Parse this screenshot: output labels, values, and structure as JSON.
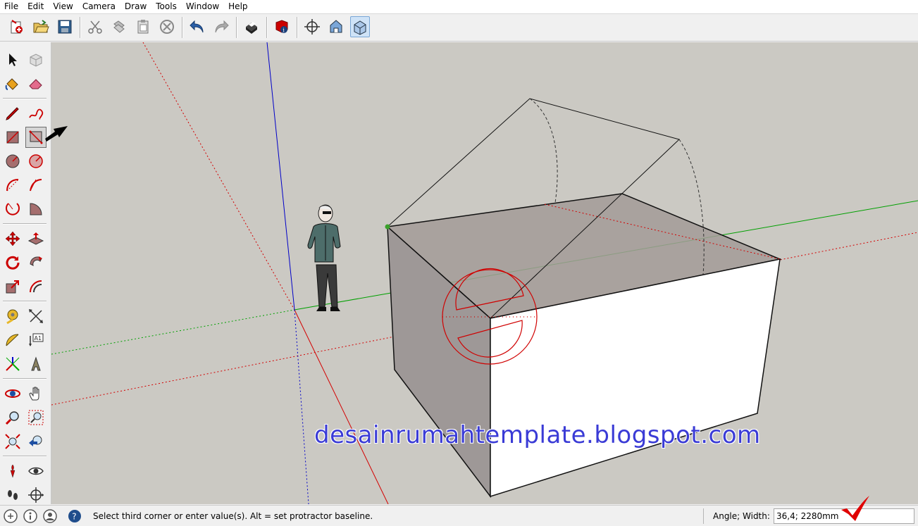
{
  "menubar": {
    "items": [
      "File",
      "Edit",
      "View",
      "Camera",
      "Draw",
      "Tools",
      "Window",
      "Help"
    ]
  },
  "toolbar": {
    "buttons": [
      {
        "name": "new-model-button",
        "icon": "new-file-icon"
      },
      {
        "name": "open-button",
        "icon": "open-folder-icon"
      },
      {
        "name": "save-button",
        "icon": "save-disk-icon"
      },
      {
        "name": "cut-button",
        "icon": "scissors-icon"
      },
      {
        "name": "copy-button",
        "icon": "copy-icon"
      },
      {
        "name": "paste-button",
        "icon": "paste-icon"
      },
      {
        "name": "erase-button",
        "icon": "delete-circle-icon"
      },
      {
        "name": "undo-button",
        "icon": "undo-arrow-icon"
      },
      {
        "name": "redo-button",
        "icon": "redo-arrow-icon"
      },
      {
        "name": "print-button",
        "icon": "printer-icon"
      },
      {
        "name": "model-info-button",
        "icon": "model-info-icon"
      },
      {
        "name": "make-component-button",
        "icon": "crosshair-icon"
      },
      {
        "name": "iso-view-button",
        "icon": "house-blue-icon"
      },
      {
        "name": "front-view-button",
        "icon": "house-box-icon"
      }
    ]
  },
  "left_tools": [
    "select-icon",
    "make-component-icon",
    "paint-bucket-icon",
    "eraser-icon",
    "pencil-line-icon",
    "freehand-icon",
    "rectangle-icon",
    "rotated-rectangle-icon",
    "circle-icon",
    "polygon-icon",
    "arc-icon",
    "two-point-arc-icon",
    "three-point-arc-icon",
    "pie-icon",
    "move-icon",
    "push-pull-icon",
    "rotate-icon",
    "follow-me-icon",
    "scale-icon",
    "offset-icon",
    "tape-measure-icon",
    "dimension-icon",
    "protractor-icon",
    "text-icon",
    "axes-icon",
    "3d-text-icon",
    "orbit-icon",
    "pan-icon",
    "zoom-icon",
    "zoom-window-icon",
    "zoom-extents-icon",
    "previous-view-icon",
    "position-camera-icon",
    "look-around-icon",
    "walk-icon",
    "section-plane-icon"
  ],
  "viewport": {
    "watermark": "desainrumahtemplate.blogspot.com"
  },
  "statusbar": {
    "message": "Select third corner or enter value(s). Alt = set protractor baseline.",
    "vcb_label": "Angle; Width:",
    "vcb_value": "36,4; 2280mm"
  },
  "colors": {
    "viewport_bg": "#cbc9c3",
    "axis_red": "#d40000",
    "axis_green": "#00a000",
    "axis_blue": "#0000c8",
    "protractor": "#d00000",
    "watermark": "#3a3bd6"
  }
}
